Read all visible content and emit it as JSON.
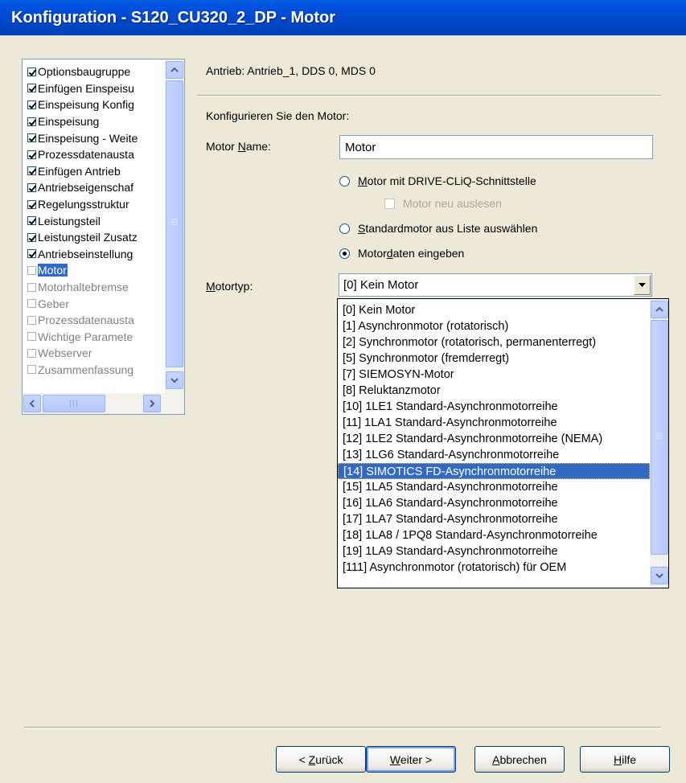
{
  "window": {
    "title": "Konfiguration - S120_CU320_2_DP - Motor"
  },
  "tree": {
    "items": [
      {
        "label": "Optionsbaugruppe",
        "checked": true
      },
      {
        "label": "Einfügen Einspeisu",
        "checked": true
      },
      {
        "label": "Einspeisung Konfig",
        "checked": true
      },
      {
        "label": "Einspeisung",
        "checked": true
      },
      {
        "label": "Einspeisung - Weite",
        "checked": true
      },
      {
        "label": "Prozessdatenausta",
        "checked": true
      },
      {
        "label": "Einfügen Antrieb",
        "checked": true
      },
      {
        "label": "Antriebseigenschaf",
        "checked": true
      },
      {
        "label": "Regelungsstruktur",
        "checked": true
      },
      {
        "label": "Leistungsteil",
        "checked": true
      },
      {
        "label": "Leistungsteil Zusatz",
        "checked": true
      },
      {
        "label": "Antriebseinstellung",
        "checked": true
      },
      {
        "label": "Motor",
        "checked": false,
        "selected": true
      },
      {
        "label": "Motorhaltebremse",
        "checked": false
      },
      {
        "label": "Geber",
        "checked": false
      },
      {
        "label": "Prozessdatenausta",
        "checked": false
      },
      {
        "label": "Wichtige Paramete",
        "checked": false
      },
      {
        "label": "Webserver",
        "checked": false
      },
      {
        "label": "Zusammenfassung",
        "checked": false
      }
    ],
    "hscroll_grip": "|||"
  },
  "drive_info": "Antrieb: Antrieb_1, DDS 0, MDS 0",
  "configure_prompt": "Konfigurieren Sie den Motor:",
  "motor_name": {
    "label": "Motor Name:",
    "value": "Motor"
  },
  "options": {
    "drive_cliq": "Motor mit DRIVE-CLiQ-Schnittstelle",
    "reread": "Motor neu auslesen",
    "standard_list": "Standardmotor aus Liste auswählen",
    "enter_data": "Motordaten eingeben",
    "selected": "enter_data"
  },
  "motortype": {
    "label": "Motortyp:",
    "value": "[0] Kein Motor",
    "options": [
      "[0] Kein Motor",
      "[1] Asynchronmotor (rotatorisch)",
      "[2] Synchronmotor (rotatorisch, permanenterregt)",
      "[5] Synchronmotor (fremderregt)",
      "[7] SIEMOSYN-Motor",
      "[8] Reluktanzmotor",
      "[10] 1LE1 Standard-Asynchronmotorreihe",
      "[11] 1LA1 Standard-Asynchronmotorreihe",
      "[12] 1LE2 Standard-Asynchronmotorreihe (NEMA)",
      "[13] 1LG6 Standard-Asynchronmotorreihe",
      "[14] SIMOTICS FD-Asynchronmotorreihe",
      "[15] 1LA5 Standard-Asynchronmotorreihe",
      "[16] 1LA6 Standard-Asynchronmotorreihe",
      "[17] 1LA7 Standard-Asynchronmotorreihe",
      "[18] 1LA8 / 1PQ8 Standard-Asynchronmotorreihe",
      "[19] 1LA9 Standard-Asynchronmotorreihe",
      "[111] Asynchronmotor (rotatorisch) für OEM"
    ],
    "highlighted": "[14] SIMOTICS FD-Asynchronmotorreihe"
  },
  "buttons": {
    "back": "< Zurück",
    "next": "Weiter >",
    "cancel": "Abbrechen",
    "help": "Hilfe"
  },
  "icons": {
    "scroll_up": "chevron-up-icon",
    "scroll_down": "chevron-down-icon",
    "scroll_left": "chevron-left-icon",
    "scroll_right": "chevron-right-icon",
    "combo": "dropdown-arrow-icon"
  },
  "colors": {
    "title_bar": "#0054E3",
    "selection": "#316AC5",
    "dialog_bg": "#ECE9D8"
  }
}
